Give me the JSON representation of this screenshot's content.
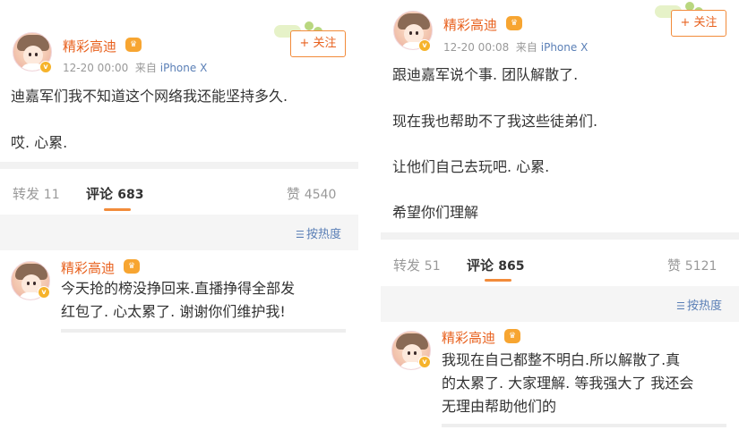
{
  "left": {
    "author": {
      "name": "精彩高迪",
      "level_badge": "♛",
      "verified": "v"
    },
    "meta": {
      "time": "12-20 00:00",
      "from_label": "来自",
      "source": "iPhone X"
    },
    "follow_label": "+ 关注",
    "body": [
      "迪嘉军们我不知道这个网络我还能坚持多久.",
      "哎. 心累."
    ],
    "tabs": {
      "repost_label": "转发",
      "repost_count": "11",
      "comment_label": "评论",
      "comment_count": "683",
      "like_label": "赞",
      "like_count": "4540"
    },
    "sort_label": "按热度",
    "comment": {
      "author": "精彩高迪",
      "lines": [
        "今天抢的榜没挣回来.直播挣得全部发",
        "红包了. 心太累了. 谢谢你们维护我!"
      ]
    }
  },
  "right": {
    "author": {
      "name": "精彩高迪",
      "level_badge": "♛",
      "verified": "v"
    },
    "meta": {
      "time": "12-20 00:08",
      "from_label": "来自",
      "source": "iPhone X"
    },
    "follow_label": "+ 关注",
    "body": [
      "跟迪嘉军说个事. 团队解散了.",
      "现在我也帮助不了我这些徒弟们.",
      "让他们自己去玩吧. 心累.",
      "希望你们理解"
    ],
    "tabs": {
      "repost_label": "转发",
      "repost_count": "51",
      "comment_label": "评论",
      "comment_count": "865",
      "like_label": "赞",
      "like_count": "5121"
    },
    "sort_label": "按热度",
    "comment": {
      "author": "精彩高迪",
      "lines": [
        "我现在自己都整不明白.所以解散了.真",
        "的太累了. 大家理解. 等我强大了 我还会",
        "无理由帮助他们的"
      ]
    }
  },
  "icons": {
    "sort_icon": "sort-lines-icon",
    "verified_icon": "verified-v-icon",
    "level_icon": "crown-level-icon"
  },
  "colors": {
    "username": "#e8611e",
    "follow_border": "#f28b3a",
    "source": "#5a7fb6",
    "tab_active_underline": "#f28b3a"
  }
}
